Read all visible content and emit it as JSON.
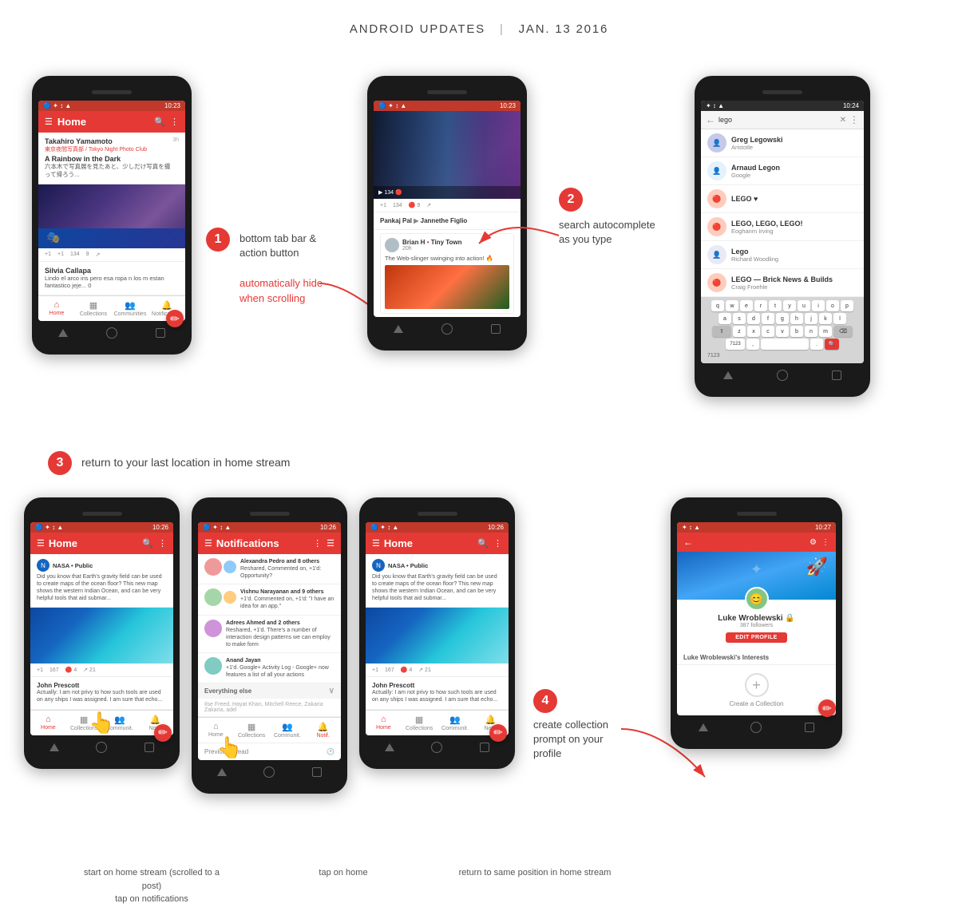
{
  "header": {
    "title": "ANDROID UPDATES",
    "divider": "|",
    "date": "JAN. 13 2016"
  },
  "annotations": {
    "step1_badge": "1",
    "step1_line1": "bottom tab bar &",
    "step1_line2": "action button",
    "step1_line3": "automatically hide",
    "step1_line4": "when scrolling",
    "step2_badge": "2",
    "step2_line1": "search autocomplete",
    "step2_line2": "as you type",
    "step3_badge": "3",
    "step3_text": "return to your last location in home stream",
    "step4_badge": "4",
    "step4_line1": "create collection",
    "step4_line2": "prompt on your",
    "step4_line3": "profile"
  },
  "phones": {
    "phone1": {
      "status_time": "10:23",
      "app_bar_title": "Home",
      "post1_author": "Takahiro Yamamoto",
      "post1_sub": "東京夜間写真部 / Tokyo Night Photo Club",
      "post1_title": "A Rainbow in the Dark",
      "post1_text": "六本木で写真展を見たあと、少しだけ写真を撮って帰ろう...",
      "post1_time": "3h",
      "action_plus1": "+1",
      "action_count1": "134",
      "action_comments": "9",
      "post2_author": "Silvia Callapa",
      "post2_text": "Lindo el arco iris pero esa ropa n los m estan fantastico jeje... 0",
      "tabs": [
        "Home",
        "Collections",
        "Communities",
        "Notifications"
      ]
    },
    "phone2": {
      "status_time": "10:23",
      "post_author": "Pankaj Pal",
      "post_sub": "Jannethe Figlio",
      "action_plus1": "+1",
      "action_count": "134",
      "action_comments": "9",
      "inner_author": "Brian H",
      "inner_sub": "Tiny Town",
      "inner_time": "20h",
      "inner_text": "The Web-slinger swinging into action! 🔥"
    },
    "phone3": {
      "status_time": "10:24",
      "search_placeholder": "lego",
      "results": [
        {
          "name": "Greg Legowski",
          "sub": "Aristotle",
          "icon": "person"
        },
        {
          "name": "Arnaud Legon",
          "sub": "Google",
          "icon": "person"
        },
        {
          "name": "LEGO ♥",
          "sub": "",
          "icon": "lego"
        },
        {
          "name": "LEGO, LEGO, LEGO!",
          "sub": "Eoghanm Irving",
          "icon": "lego2"
        },
        {
          "name": "Lego",
          "sub": "Richard Woodling",
          "icon": "person"
        },
        {
          "name": "LEGO — Brick News & Builds",
          "sub": "Craig Froehle",
          "icon": "lego3"
        }
      ],
      "keyboard_row1": [
        "q",
        "w",
        "e",
        "r",
        "t",
        "y",
        "u",
        "i",
        "o",
        "p"
      ],
      "keyboard_row2": [
        "a",
        "s",
        "d",
        "f",
        "g",
        "h",
        "j",
        "k",
        "l"
      ],
      "keyboard_row3": [
        "z",
        "x",
        "c",
        "v",
        "b",
        "n",
        "m"
      ],
      "keyboard_row4": [
        "7123",
        "space",
        "search"
      ]
    },
    "phone4_home": {
      "status_time": "10:26",
      "app_bar_title": "Home",
      "post_author": "NASA • Public",
      "post_text": "Did you know that Earth's gravity field can be used to create maps of the ocean floor? This new map shows the western Indian Ocean, and can be very helpful tools that aid submar...",
      "action_count": "167",
      "post2_author": "John Prescott",
      "post2_text": "Actually: I am not privy to how such tools are used on any ships I was assigned. I am sure that echo..."
    },
    "phone4_notifications": {
      "status_time": "10:26",
      "app_bar_title": "Notifications",
      "notif1_name": "Alexandra Pedro and 8 others",
      "notif1_text": "Reshared, Commented on, +1'd: Opportunity?",
      "notif2_name": "Vishnu Narayanan and 9 others",
      "notif2_text": "+1'd. Commented on, +1'd: \"I have an idea for an app.\"",
      "notif3_name": "Adrees Ahmed and 2 others",
      "notif3_text": "Reshared, +1'd. There's a number of interaction design patterns we can employ to make form",
      "notif4_name": "Anand Jayan",
      "notif4_text": "+1'd. Google+ Activity Log - Google+ now features a list of all your actions",
      "section_everything": "Everything else",
      "section_people": "Ilse Freed, Hayat Khan, Mitchell Reece, Zakaria Zakaria, adel",
      "prev_read": "Previously read",
      "tabs": [
        "Home",
        "Collections",
        "Communities",
        "Notifications"
      ]
    },
    "phone5_home": {
      "status_time": "10:26",
      "app_bar_title": "Home",
      "post_author": "NASA • Public",
      "post_text": "Did you know that Earth's gravity field can be used to create maps of the ocean floor? This new map shows the western Indian Ocean, and can be very helpful tools that aid submar...",
      "action_count": "167",
      "post2_author": "John Prescott",
      "post2_text": "Actually: I am not privy to how such tools are used on any ships I was assigned. I am sure that echo..."
    },
    "phone6_profile": {
      "status_time": "10:27",
      "profile_name": "Luke Wroblewski 🔒",
      "followers": "387 followers",
      "edit_label": "EDIT PROFILE",
      "interests_label": "Luke Wroblewski's Interests",
      "create_collection": "Create a Collection"
    }
  },
  "bottom_labels": {
    "phone4_label1": "start on home stream\n(scrolled to a post)",
    "phone4_label2": "tap on notifications",
    "phone5_label": "tap on home",
    "phone6_label": "return to same position\nin home stream",
    "phone7_label": ""
  },
  "icons": {
    "menu": "☰",
    "search": "🔍",
    "more": "⋮",
    "back": "←",
    "close": "✕",
    "mic": "🎤",
    "pencil": "✏",
    "plus": "+",
    "home": "⌂",
    "collections": "▦",
    "communities": "👥",
    "notifications": "🔔"
  }
}
